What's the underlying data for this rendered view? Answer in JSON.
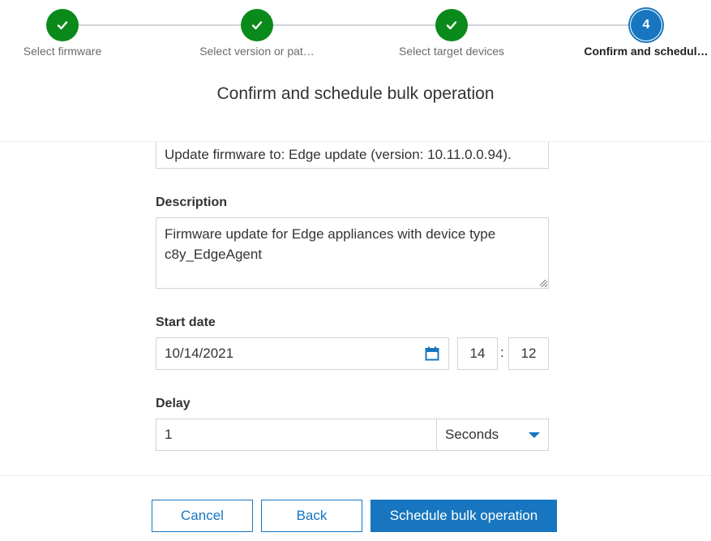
{
  "stepper": {
    "steps": [
      {
        "label": "Select firmware",
        "state": "done",
        "icon": "check-icon"
      },
      {
        "label": "Select version or pat…",
        "state": "done",
        "icon": "check-icon"
      },
      {
        "label": "Select target devices",
        "state": "done",
        "icon": "check-icon"
      },
      {
        "label": "Confirm and schedul…",
        "state": "active",
        "number": "4"
      }
    ]
  },
  "page_title": "Confirm and schedule bulk operation",
  "form": {
    "name_value": "Update firmware to: Edge update (version: 10.11.0.0.94).",
    "description": {
      "label": "Description",
      "value": "Firmware update for Edge appliances with device type\nc8y_EdgeAgent"
    },
    "start_date": {
      "label": "Start date",
      "date": "10/14/2021",
      "hour": "14",
      "separator": ":",
      "minute": "12",
      "icon": "calendar-icon"
    },
    "delay": {
      "label": "Delay",
      "value": "1",
      "unit": "Seconds",
      "icon": "caret-down-icon"
    }
  },
  "buttons": {
    "cancel": "Cancel",
    "back": "Back",
    "schedule": "Schedule bulk operation"
  },
  "colors": {
    "done": "#0b8a1c",
    "active": "#1776bf",
    "primary": "#1776bf",
    "border": "#cfd4da"
  }
}
